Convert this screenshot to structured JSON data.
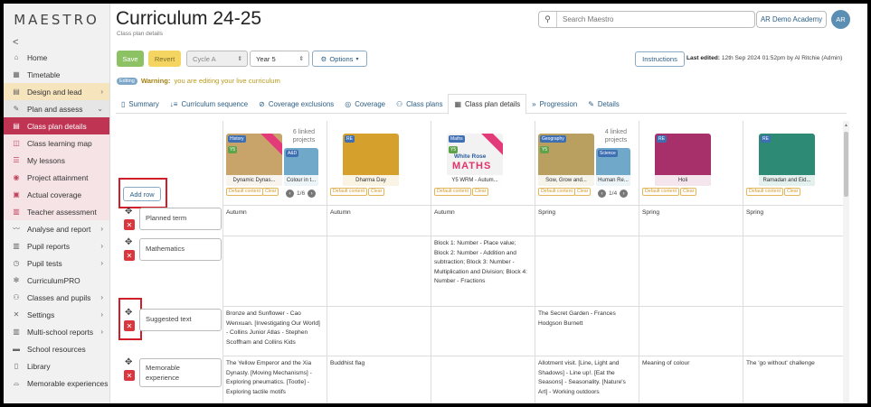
{
  "sidebar": {
    "logo": "MAESTRO",
    "collapse": "<",
    "items": [
      {
        "icon": "⌂",
        "label": "Home",
        "state": "normal"
      },
      {
        "icon": "▦",
        "label": "Timetable",
        "state": "normal"
      },
      {
        "icon": "▤",
        "label": "Design and lead",
        "state": "orange",
        "chevron": "›"
      },
      {
        "icon": "✎",
        "label": "Plan and assess",
        "state": "expanded",
        "chevron": "⌄"
      },
      {
        "icon": "▤",
        "label": "Class plan details",
        "state": "active"
      },
      {
        "icon": "◫",
        "label": "Class learning map",
        "state": "sub"
      },
      {
        "icon": "☰",
        "label": "My lessons",
        "state": "sub"
      },
      {
        "icon": "◉",
        "label": "Project attainment",
        "state": "sub"
      },
      {
        "icon": "▣",
        "label": "Actual coverage",
        "state": "sub"
      },
      {
        "icon": "▥",
        "label": "Teacher assessment",
        "state": "sub"
      },
      {
        "icon": "〰",
        "label": "Analyse and report",
        "state": "normal",
        "chevron": "›"
      },
      {
        "icon": "▥",
        "label": "Pupil reports",
        "state": "normal",
        "chevron": "›"
      },
      {
        "icon": "◷",
        "label": "Pupil tests",
        "state": "normal",
        "chevron": "›"
      },
      {
        "icon": "✻",
        "label": "CurriculumPRO",
        "state": "normal"
      },
      {
        "icon": "⚇",
        "label": "Classes and pupils",
        "state": "normal",
        "chevron": "›"
      },
      {
        "icon": "✕",
        "label": "Settings",
        "state": "normal",
        "chevron": "›"
      },
      {
        "icon": "▥",
        "label": "Multi-school reports",
        "state": "normal",
        "chevron": "›"
      },
      {
        "icon": "▬",
        "label": "School resources",
        "state": "normal"
      },
      {
        "icon": "▯",
        "label": "Library",
        "state": "normal"
      },
      {
        "icon": "⌓",
        "label": "Memorable experiences",
        "state": "normal"
      }
    ]
  },
  "header": {
    "title": "Curriculum 24-25",
    "subtitle": "Class plan details",
    "search_placeholder": "Search Maestro",
    "school": "AR Demo Academy",
    "avatar": "AR"
  },
  "toolbar": {
    "save": "Save",
    "revert": "Revert",
    "cycle": "Cycle A",
    "year": "Year 5",
    "options": "Options",
    "instructions": "Instructions",
    "last_edited_label": "Last edited:",
    "last_edited_value": "12th Sep 2024 01:52pm by Al Ritchie (Admin)"
  },
  "notice": {
    "badge": "Editing",
    "warning": "Warning:",
    "text": "you are editing your live curriculum"
  },
  "tabs": [
    {
      "icon": "▯",
      "label": "Summary"
    },
    {
      "icon": "↓≡",
      "label": "Curriculum sequence"
    },
    {
      "icon": "⊘",
      "label": "Coverage exclusions"
    },
    {
      "icon": "◎",
      "label": "Coverage"
    },
    {
      "icon": "⚇",
      "label": "Class plans"
    },
    {
      "icon": "▦",
      "label": "Class plan details",
      "active": true
    },
    {
      "icon": "»",
      "label": "Progression"
    },
    {
      "icon": "✎",
      "label": "Details"
    }
  ],
  "grid": {
    "add_row": "Add row",
    "chip_default": "Default content",
    "chip_clear": "Clear",
    "projects": [
      {
        "thumb_caption": "Dynamic Dynas...",
        "subject": "History",
        "subject_color": "#3f6fb3",
        "year": "Y5",
        "bg": "#c9a46a",
        "linked": "6 linked projects",
        "page": "1/6",
        "second_caption": "Colour in t...",
        "second_subject": "A&D",
        "new": true
      },
      {
        "thumb_caption": "Dharma Day",
        "subject": "RE",
        "subject_color": "#3f6fb3",
        "year": "",
        "bg": "#d6a02c"
      },
      {
        "thumb_caption": "Y5 WRM - Autum...",
        "subject": "Maths",
        "subject_color": "#3f6fb3",
        "year": "Y5",
        "bg": "#f2f2f2",
        "logo_top": "White Rose",
        "logo_bottom": "MATHS",
        "new": true
      },
      {
        "thumb_caption": "Sow, Grow and...",
        "subject": "Geography",
        "subject_color": "#3f6fb3",
        "year": "Y5",
        "bg": "#b9a060",
        "linked": "4 linked projects",
        "page": "1/4",
        "second_caption": "Human Re...",
        "second_subject": "Science"
      },
      {
        "thumb_caption": "Holi",
        "subject": "RE",
        "subject_color": "#3f6fb3",
        "year": "",
        "bg": "#a8306a"
      },
      {
        "thumb_caption": "Ramadan and Eid...",
        "subject": "RE",
        "subject_color": "#3f6fb3",
        "year": "",
        "bg": "#2d8a74"
      }
    ],
    "rows": [
      {
        "label": "Planned term",
        "cells": [
          "Autumn",
          "Autumn",
          "Autumn",
          "Spring",
          "Spring",
          "Spring"
        ]
      },
      {
        "label": "Mathematics",
        "cells": [
          "",
          "",
          "Block 1: Number - Place value; Block 2: Number - Addition and subtraction; Block 3: Number - Multiplication and Division; Block 4: Number - Fractions",
          "",
          "",
          ""
        ]
      },
      {
        "label": "Suggested text",
        "cells": [
          "Bronze and Sunflower - Cao Wenxuan. [Investigating Our World] - Collins Junior Atlas - Stephen Scoffham and Collins Kids",
          "",
          "",
          "The Secret Garden - Frances Hodgson Burnett",
          "",
          ""
        ]
      },
      {
        "label": "Memorable experience",
        "cells": [
          "The Yellow Emperor and the Xia Dynasty. [Moving Mechanisms] - Exploring pneumatics. [Tootle] - Exploring tactile motifs",
          "Buddhist flag",
          "",
          "Allotment visit. [Line, Light and Shadows] - Line up!. [Eat the Seasons] - Seasonality. [Nature's Art] - Working outdoors",
          "Meaning of colour",
          "The 'go without' challenge"
        ]
      }
    ]
  },
  "colors": {
    "brand_red": "#bf3453",
    "link_blue": "#2a5d84",
    "save_green": "#8cc164",
    "revert_yellow": "#f4d561",
    "highlight_red": "#d01f2a"
  }
}
